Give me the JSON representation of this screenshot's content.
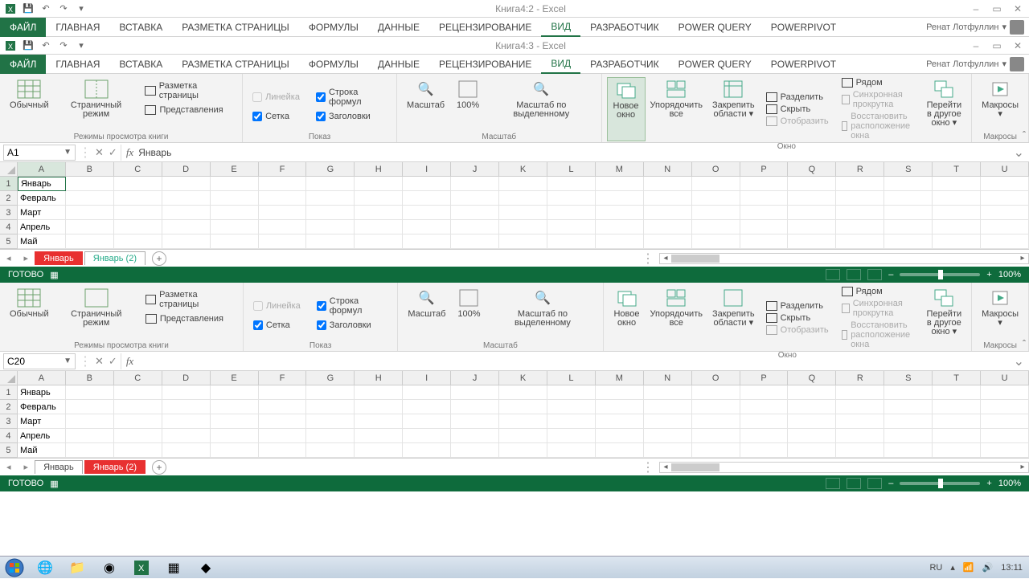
{
  "app1": {
    "title": "Книга4:2 - Excel",
    "tabs_file": "ФАЙЛ",
    "tabs": [
      "ГЛАВНАЯ",
      "ВСТАВКА",
      "РАЗМЕТКА СТРАНИЦЫ",
      "ФОРМУЛЫ",
      "ДАННЫЕ",
      "РЕЦЕНЗИРОВАНИЕ",
      "ВИД",
      "РАЗРАБОТЧИК",
      "POWER QUERY",
      "POWERPIVOT"
    ],
    "active_tab": 6,
    "user": "Ренат Лотфуллин"
  },
  "app2": {
    "title": "Книга4:3 - Excel",
    "tabs_file": "ФАЙЛ",
    "tabs": [
      "ГЛАВНАЯ",
      "ВСТАВКА",
      "РАЗМЕТКА СТРАНИЦЫ",
      "ФОРМУЛЫ",
      "ДАННЫЕ",
      "РЕЦЕНЗИРОВАНИЕ",
      "ВИД",
      "РАЗРАБОТЧИК",
      "POWER QUERY",
      "POWERPIVOT"
    ],
    "active_tab": 6,
    "user": "Ренат Лотфуллин"
  },
  "ribbon": {
    "views": {
      "normal": "Обычный",
      "page": "Страничный режим",
      "layout": "Разметка страницы",
      "custom": "Представления",
      "group": "Режимы просмотра книги"
    },
    "show": {
      "ruler": "Линейка",
      "formula": "Строка формул",
      "grid": "Сетка",
      "headings": "Заголовки",
      "group": "Показ"
    },
    "zoom": {
      "zoom": "Масштаб",
      "z100": "100%",
      "tosel": "Масштаб по выделенному",
      "group": "Масштаб"
    },
    "window": {
      "new": "Новое окно",
      "arrange": "Упорядочить все",
      "freeze": "Закрепить области",
      "split": "Разделить",
      "hide": "Скрыть",
      "unhide": "Отобразить",
      "side": "Рядом",
      "sync": "Синхронная прокрутка",
      "reset": "Восстановить расположение окна",
      "switch": "Перейти в другое окно",
      "group": "Окно"
    },
    "macros": {
      "btn": "Макросы",
      "group": "Макросы"
    }
  },
  "fbar1": {
    "name": "A1",
    "formula": "Январь"
  },
  "fbar2": {
    "name": "C20",
    "formula": ""
  },
  "cols": [
    "A",
    "B",
    "C",
    "D",
    "E",
    "F",
    "G",
    "H",
    "I",
    "J",
    "K",
    "L",
    "M",
    "N",
    "O",
    "P",
    "Q",
    "R",
    "S",
    "T",
    "U"
  ],
  "rows": [
    {
      "n": "1",
      "v": "Январь"
    },
    {
      "n": "2",
      "v": "Февраль"
    },
    {
      "n": "3",
      "v": "Март"
    },
    {
      "n": "4",
      "v": "Апрель"
    },
    {
      "n": "5",
      "v": "Май"
    }
  ],
  "sheets1": {
    "active_red": "Январь",
    "other": "Январь (2)"
  },
  "sheets2": {
    "other": "Январь",
    "active_red": "Январь (2)"
  },
  "status": {
    "ready": "ГОТОВО",
    "zoom": "100%"
  },
  "tray": {
    "lang": "RU",
    "time": "13:11"
  }
}
